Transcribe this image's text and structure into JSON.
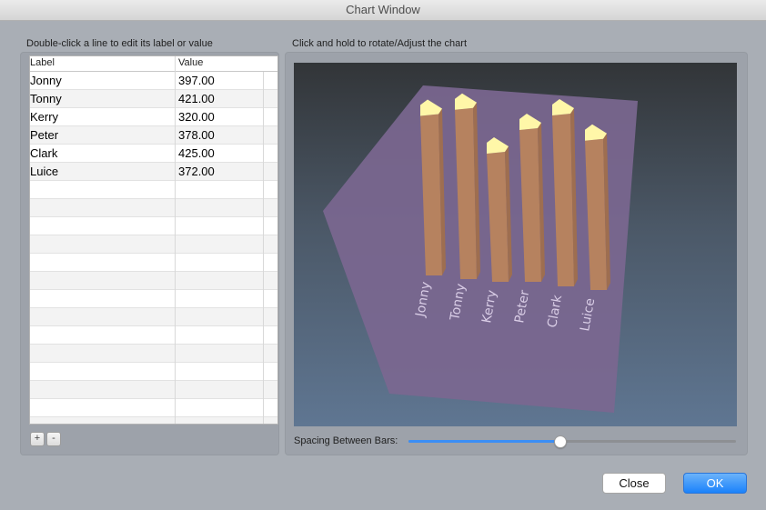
{
  "window": {
    "title": "Chart Window"
  },
  "left": {
    "caption": "Double-click a line to edit its label or value",
    "columns": {
      "label": "Label",
      "value": "Value"
    },
    "rows": [
      {
        "label": "Jonny",
        "value": "397.00"
      },
      {
        "label": "Tonny",
        "value": "421.00"
      },
      {
        "label": "Kerry",
        "value": "320.00"
      },
      {
        "label": "Peter",
        "value": "378.00"
      },
      {
        "label": "Clark",
        "value": "425.00"
      },
      {
        "label": "Luice",
        "value": "372.00"
      }
    ],
    "add_label": "+",
    "remove_label": "-"
  },
  "right": {
    "caption": "Click and hold to rotate/Adjust the chart",
    "spacing_label": "Spacing Between Bars:",
    "spacing_value": 0.46
  },
  "chart_data": {
    "type": "bar",
    "categories": [
      "Jonny",
      "Tonny",
      "Kerry",
      "Peter",
      "Clark",
      "Luice"
    ],
    "values": [
      397,
      421,
      320,
      378,
      425,
      372
    ]
  },
  "colors": {
    "bar_side": "#b6825f",
    "bar_top": "#fff7a8",
    "floor": "#7b6790",
    "accent": "#3b8ef5"
  },
  "buttons": {
    "close": "Close",
    "ok": "OK"
  }
}
